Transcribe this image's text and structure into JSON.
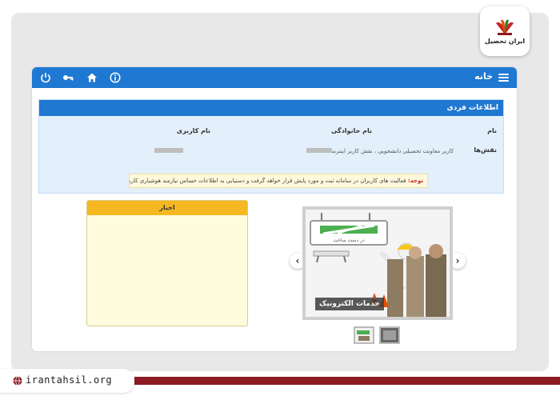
{
  "brand": {
    "logo_text": "ایران تحصیل",
    "site_url": "irantahsil.org"
  },
  "topbar": {
    "home_label": "خانه"
  },
  "personal_info": {
    "title": "اطلاعات فردی",
    "fields": {
      "first_name_label": "نام",
      "last_name_label": "نام خانوادگی",
      "username_label": "نام کاربری",
      "roles_label": "نقش‌ها",
      "roles_value": "کاربر معاونت تحصیلی دانشجویی ، نقش کاربر اینترنت"
    },
    "notice_label": "توجه:",
    "notice_text": " فعالیت های کاربران در سامانه ثبت و مورد پایش قرار خواهد گرفت و دستیابی به اطلاعات حساس نیازمند هوشیاری کاربران است."
  },
  "news": {
    "title": "اخبار"
  },
  "slider": {
    "caption": "خدمات الکترونیک",
    "sign_text": "در دست ساخت"
  },
  "colors": {
    "primary": "#1f78d1",
    "news_header": "#f5b722",
    "footer": "#8b1a23"
  }
}
